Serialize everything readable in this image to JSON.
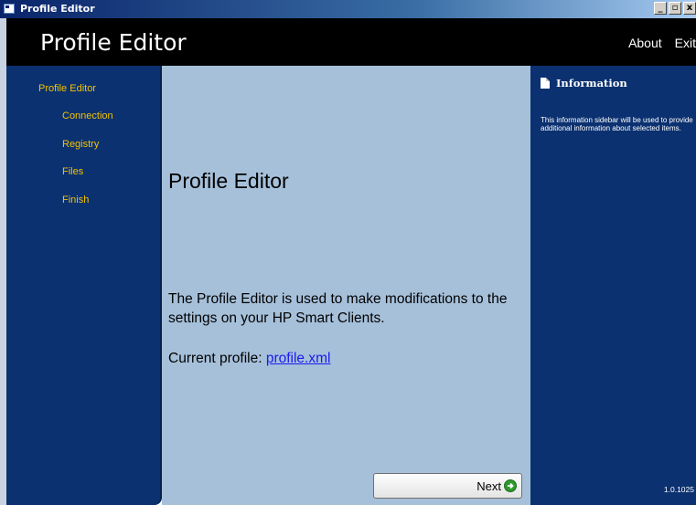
{
  "window": {
    "title": "Profile Editor",
    "controls": [
      "_",
      "▫",
      "x"
    ]
  },
  "header": {
    "app_title": "Profile Editor",
    "nav": {
      "about": "About",
      "exit": "Exit"
    }
  },
  "sidebar": {
    "items": [
      {
        "label": "Profile Editor"
      },
      {
        "label": "Connection"
      },
      {
        "label": "Registry"
      },
      {
        "label": "Files"
      },
      {
        "label": "Finish"
      }
    ]
  },
  "main": {
    "heading": "Profile Editor",
    "description": "The Profile Editor is used to make modifications to the settings on your HP Smart Clients.",
    "current_profile_label": "Current profile:",
    "current_profile_value": "profile.xml",
    "next_label": "Next"
  },
  "info_panel": {
    "title": "Information",
    "text": "This information sidebar will be used to provide additional information about selected items.",
    "version": "1.0.1025"
  },
  "colors": {
    "sidebar_bg": "#0b3170",
    "main_bg": "#a6c0da",
    "nav_accent": "#f4c300",
    "header_bg": "#000000",
    "link": "#1a1aee",
    "next_icon": "#2e9a2e"
  },
  "icons": [
    "app-icon",
    "minimize-icon",
    "maximize-icon",
    "close-icon",
    "next-arrow-icon",
    "info-page-icon"
  ]
}
